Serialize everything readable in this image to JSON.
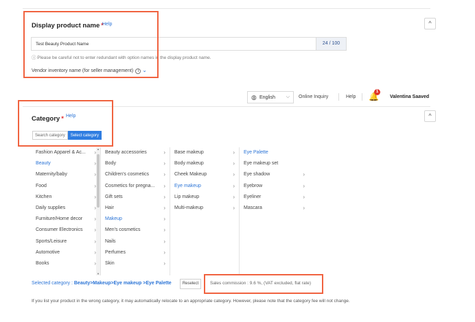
{
  "product_name_section": {
    "title": "Display product name",
    "required_mark": "*",
    "help": "Help",
    "input_value": "Test Beauty Product Name",
    "char_count": "24 / 100",
    "notice": "ⓘ Please be careful not to enter redundant with option names in the display product name.",
    "vendor_label": "Vendor inventory name (for seller management)",
    "collapse_icon": "^"
  },
  "topbar": {
    "language": "English",
    "online_inquiry": "Online Inquiry",
    "help": "Help",
    "notification_count": "1",
    "user_name": "Valentina Saaved"
  },
  "category_section": {
    "title": "Category",
    "required_mark": "*",
    "help": "Help",
    "collapse_icon": "^",
    "tabs": [
      {
        "label": "Search category",
        "active": false
      },
      {
        "label": "Select category",
        "active": true
      }
    ],
    "columns": [
      {
        "items": [
          {
            "label": "Fashion Apparel & Ac...",
            "selected": false,
            "arrow": true
          },
          {
            "label": "Beauty",
            "selected": true,
            "arrow": true
          },
          {
            "label": "Maternity/baby",
            "selected": false,
            "arrow": true
          },
          {
            "label": "Food",
            "selected": false,
            "arrow": true
          },
          {
            "label": "Kitchen",
            "selected": false,
            "arrow": true
          },
          {
            "label": "Daily supplies",
            "selected": false,
            "arrow": true
          },
          {
            "label": "Furniture/Home decor",
            "selected": false,
            "arrow": true
          },
          {
            "label": "Consumer Electronics",
            "selected": false,
            "arrow": true
          },
          {
            "label": "Sports/Leisure",
            "selected": false,
            "arrow": true
          },
          {
            "label": "Automotive",
            "selected": false,
            "arrow": true
          },
          {
            "label": "Books",
            "selected": false,
            "arrow": true
          }
        ]
      },
      {
        "items": [
          {
            "label": "Beauty accessories",
            "selected": false,
            "arrow": true
          },
          {
            "label": "Body",
            "selected": false,
            "arrow": true
          },
          {
            "label": "Children's cosmetics",
            "selected": false,
            "arrow": true
          },
          {
            "label": "Cosmetics for pregna...",
            "selected": false,
            "arrow": true
          },
          {
            "label": "Gift sets",
            "selected": false,
            "arrow": true
          },
          {
            "label": "Hair",
            "selected": false,
            "arrow": true
          },
          {
            "label": "Makeup",
            "selected": true,
            "arrow": true
          },
          {
            "label": "Men's cosmetics",
            "selected": false,
            "arrow": true
          },
          {
            "label": "Nails",
            "selected": false,
            "arrow": true
          },
          {
            "label": "Perfumes",
            "selected": false,
            "arrow": true
          },
          {
            "label": "Skin",
            "selected": false,
            "arrow": true
          }
        ]
      },
      {
        "items": [
          {
            "label": "Base makeup",
            "selected": false,
            "arrow": true
          },
          {
            "label": "Body makeup",
            "selected": false,
            "arrow": true
          },
          {
            "label": "Cheek Makeup",
            "selected": false,
            "arrow": true
          },
          {
            "label": "Eye makeup",
            "selected": true,
            "arrow": true
          },
          {
            "label": "Lip makeup",
            "selected": false,
            "arrow": true
          },
          {
            "label": "Multi-makeup",
            "selected": false,
            "arrow": true
          }
        ]
      },
      {
        "items": [
          {
            "label": "Eye Palette",
            "selected": true,
            "arrow": false
          },
          {
            "label": "Eye makeup set",
            "selected": false,
            "arrow": false
          },
          {
            "label": "Eye shadow",
            "selected": false,
            "arrow": true
          },
          {
            "label": "Eyebrow",
            "selected": false,
            "arrow": true
          },
          {
            "label": "Eyeliner",
            "selected": false,
            "arrow": true
          },
          {
            "label": "Mascara",
            "selected": false,
            "arrow": true
          }
        ]
      }
    ],
    "selected_prefix": "Selected category : ",
    "selected_path": "Beauty>Makeup>Eye makeup >Eye Palette",
    "reselect": "Reselect",
    "commission": "Sales commission : 9.6 %, (VAT excluded, flat rate)",
    "footnote": "If you list your product in the wrong category, it may automatically relocate to an appropriate category. However, please note that the category fee will not change."
  },
  "colors": {
    "accent": "#2f7de1",
    "highlight_box": "#f0623f",
    "link": "#2b74d6"
  }
}
